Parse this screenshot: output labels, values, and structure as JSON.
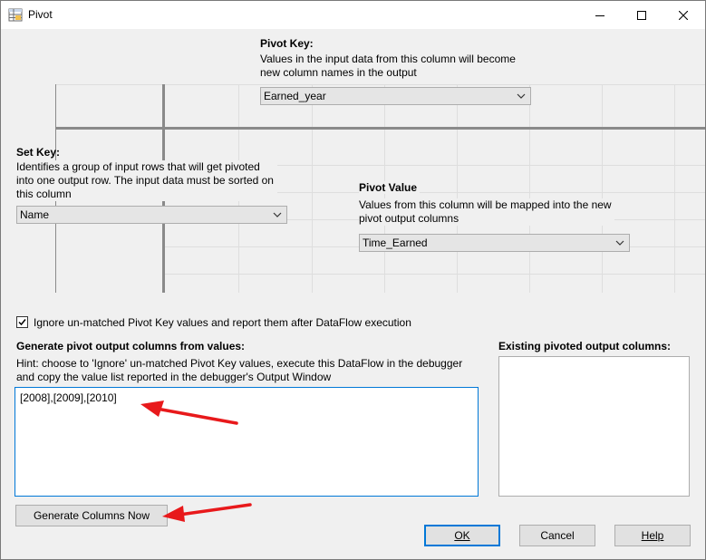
{
  "window": {
    "title": "Pivot",
    "icon": "pivot-table-icon",
    "controls": [
      "minimize-icon",
      "maximize-icon",
      "close-icon"
    ]
  },
  "pivot_key": {
    "label": "Pivot Key:",
    "description_lines": [
      "Values in the input data from this column will become",
      "new column names in the output"
    ],
    "selected": "Earned_year"
  },
  "set_key": {
    "label": "Set Key:",
    "description_lines": [
      "Identifies a group of input rows that will get pivoted",
      "into one output row. The input data must be sorted on",
      "this column"
    ],
    "selected": "Name"
  },
  "pivot_value": {
    "label": "Pivot Value",
    "description_lines": [
      "Values from this column will be mapped into the new",
      "pivot output columns"
    ],
    "selected": "Time_Earned"
  },
  "ignore_option": {
    "checked": true,
    "label": "Ignore un-matched Pivot Key values and report them after DataFlow execution"
  },
  "generate_section": {
    "label": "Generate pivot output columns from values:",
    "hint_lines": [
      "Hint: choose to 'Ignore' un-matched Pivot Key values, execute this DataFlow in the debugger",
      "and copy the value list reported in the debugger's Output Window"
    ],
    "values_text": "[2008],[2009],[2010]",
    "generate_button": "Generate Columns Now"
  },
  "existing_section": {
    "label": "Existing pivoted output columns:"
  },
  "buttons": {
    "ok": "OK",
    "cancel": "Cancel",
    "help": "Help"
  },
  "annotation_color": "#e8191b"
}
